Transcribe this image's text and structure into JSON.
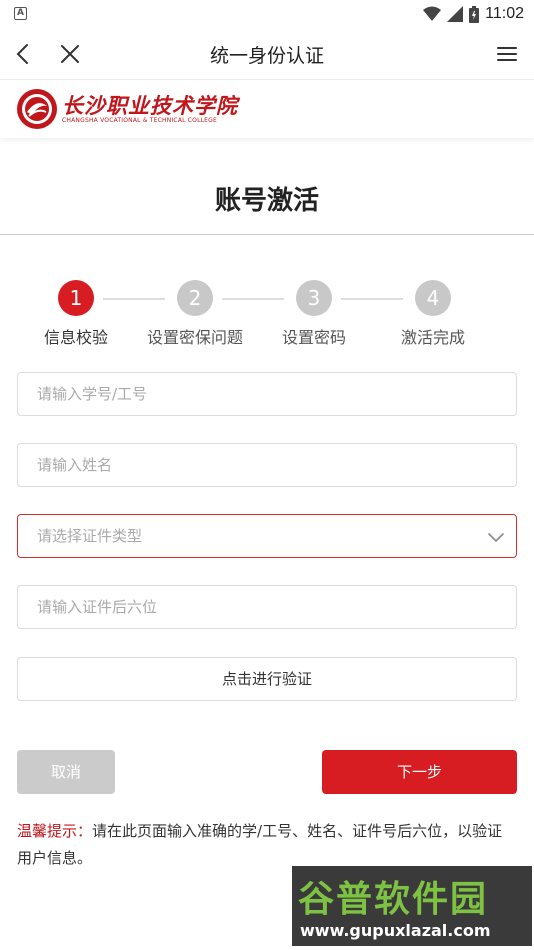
{
  "status_bar": {
    "indicator": "A",
    "time": "11:02"
  },
  "nav": {
    "title": "统一身份认证",
    "icons": {
      "back": "back-arrow-icon",
      "close": "close-icon",
      "menu": "hamburger-menu-icon"
    }
  },
  "logo": {
    "name_cn": "长沙职业技术学院",
    "name_en": "CHANGSHA VOCATIONAL & TECHNICAL COLLEGE"
  },
  "page": {
    "heading": "账号激活"
  },
  "steps": [
    {
      "number": "1",
      "label": "信息校验",
      "active": true
    },
    {
      "number": "2",
      "label": "设置密保问题",
      "active": false
    },
    {
      "number": "3",
      "label": "设置密码",
      "active": false
    },
    {
      "number": "4",
      "label": "激活完成",
      "active": false
    }
  ],
  "form": {
    "id_placeholder": "请输入学号/工号",
    "name_placeholder": "请输入姓名",
    "cert_type_placeholder": "请选择证件类型",
    "cert_last6_placeholder": "请输入证件后六位",
    "verify_label": "点击进行验证",
    "cancel_label": "取消",
    "next_label": "下一步"
  },
  "tip": {
    "title": "温馨提示：",
    "text": "请在此页面输入准确的学/工号、姓名、证件号后六位，以验证用户信息。"
  },
  "watermark": {
    "text_cn": "谷普软件园",
    "url": "www.gupuxlazal.com"
  },
  "colors": {
    "accent": "#d71d22",
    "inactive_step": "#c8c8c8",
    "cancel": "#cbcbcb",
    "watermark_green": "#7dc243"
  }
}
